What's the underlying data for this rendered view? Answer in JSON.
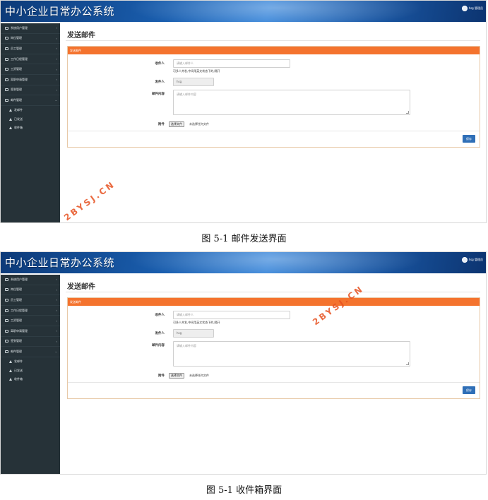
{
  "app": {
    "title": "中小企业日常办公系统",
    "user": "hsg 管理员"
  },
  "sidebar": {
    "items": [
      {
        "label": "系统用户管理",
        "arrow": "‹"
      },
      {
        "label": "岗位管理",
        "arrow": "‹"
      },
      {
        "label": "员工管理",
        "arrow": "‹"
      },
      {
        "label": "工作日程管理",
        "arrow": "‹"
      },
      {
        "label": "工资管理",
        "arrow": "‹"
      },
      {
        "label": "离职申请管理",
        "arrow": "‹"
      },
      {
        "label": "签到管理",
        "arrow": "‹"
      },
      {
        "label": "邮件管理",
        "arrow": "⌄"
      }
    ],
    "sub_items": [
      {
        "label": "发邮件"
      },
      {
        "label": "已发送"
      },
      {
        "label": "收件箱"
      }
    ]
  },
  "page": {
    "title": "发送邮件",
    "panel_title": "发送邮件"
  },
  "form": {
    "recipient_label": "收件人",
    "recipient_placeholder": "请输入邮件人",
    "recipient_help": "可多人并发,中间用英文状态下的,隔开",
    "sender_label": "发件人",
    "sender_value": "hsg",
    "content_label": "邮件内容",
    "content_placeholder": "请输入邮件内容",
    "attachment_label": "附件",
    "file_button": "选择文件",
    "file_none": "未选择任何文件",
    "save_button": "保存"
  },
  "captions": {
    "first": "图 5-1  邮件发送界面",
    "second": "图 5-1  收件箱界面"
  },
  "watermark": "2BYSJ.CN"
}
